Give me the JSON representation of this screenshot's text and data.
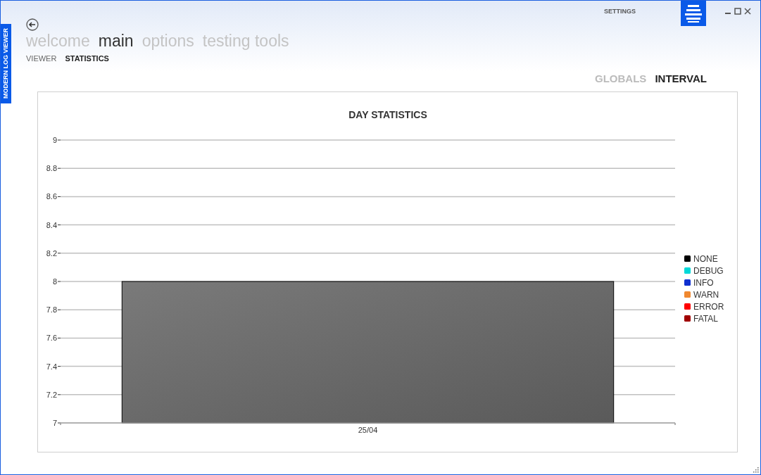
{
  "side_tab": "MODERN LOG VIEWER",
  "header": {
    "settings": "SETTINGS"
  },
  "nav": [
    {
      "label": "welcome",
      "selected": false
    },
    {
      "label": "main",
      "selected": true
    },
    {
      "label": "options",
      "selected": false
    },
    {
      "label": "testing tools",
      "selected": false
    }
  ],
  "subnav": [
    {
      "label": "VIEWER",
      "selected": false
    },
    {
      "label": "STATISTICS",
      "selected": true
    }
  ],
  "modes": [
    {
      "label": "GLOBALS",
      "selected": false
    },
    {
      "label": "INTERVAL",
      "selected": true
    }
  ],
  "chart_data": {
    "type": "bar",
    "title": "DAY STATISTICS",
    "grid": true,
    "categories": [
      "25/04"
    ],
    "ylim": [
      7,
      9
    ],
    "yticks": [
      7,
      7.2,
      7.4,
      7.6,
      7.8,
      8,
      8.2,
      8.4,
      8.6,
      8.8,
      9
    ],
    "series": [
      {
        "name": "NONE",
        "color": "#000000",
        "values": [
          8
        ]
      },
      {
        "name": "DEBUG",
        "color": "#00d8d8",
        "values": [
          null
        ]
      },
      {
        "name": "INFO",
        "color": "#1030d0",
        "values": [
          null
        ]
      },
      {
        "name": "WARN",
        "color": "#f08830",
        "values": [
          null
        ]
      },
      {
        "name": "ERROR",
        "color": "#ff0000",
        "values": [
          null
        ]
      },
      {
        "name": "FATAL",
        "color": "#a00000",
        "values": [
          null
        ]
      }
    ]
  }
}
